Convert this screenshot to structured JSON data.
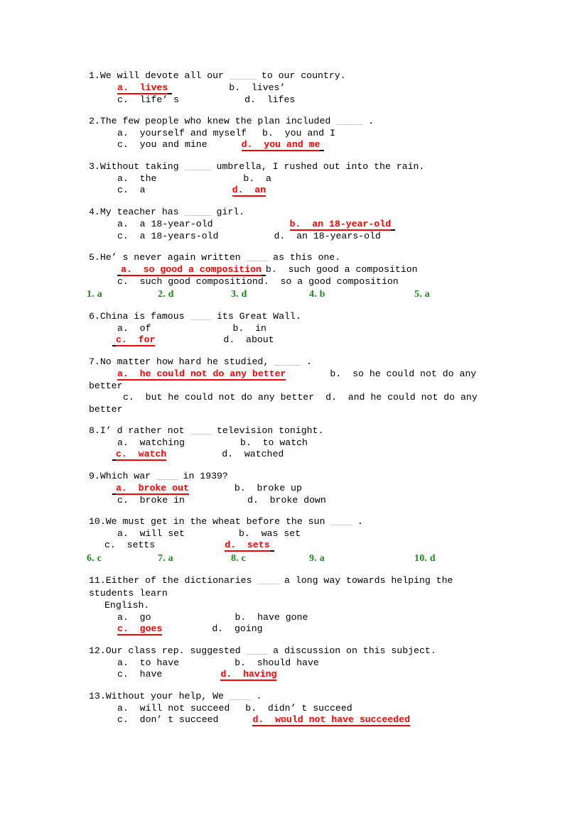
{
  "document": {
    "type": "multiple-choice-grammar-worksheet",
    "colors": {
      "answer_red": "#ff0000",
      "answer_key_green": "#1a8a1a",
      "body_text": "#000000",
      "blank_gray": "#aaaaaa",
      "page_background": "#ffffff"
    }
  },
  "questions": [
    {
      "number": "1.",
      "stem_before": "We will devote all our ",
      "blank": "_____",
      "stem_after": " to our country.",
      "a": "a.  lives",
      "b": "b.  lives’",
      "c": "c.  life’ s",
      "d": "d.  lifes",
      "correct": "a"
    },
    {
      "number": "2.",
      "stem_before": "The few people who knew the plan included ",
      "blank": "_____",
      "stem_after": " .",
      "a": "a.  yourself and myself",
      "b": "b.  you and I",
      "c": "c.  you and mine",
      "d": "d.  you and me",
      "correct": "d"
    },
    {
      "number": "3.",
      "stem_before": "Without taking ",
      "blank": "_____",
      "stem_after": " umbrella, I rushed out into the rain.",
      "a": "a.  the",
      "b": "b.  a",
      "c": "c.  a",
      "d": "d.  an",
      "correct": "d"
    },
    {
      "number": "4.",
      "stem_before": "My teacher has ",
      "blank": "_____",
      "stem_after": " girl.",
      "a": "a.  a 18-year-old",
      "b": "b.  an 18-year-old",
      "c": "c.  a 18-years-old",
      "d": "d.  an 18-years-old",
      "correct": "b"
    },
    {
      "number": "5.",
      "stem_before": "He’ s never again written ",
      "blank": "____",
      "stem_after": " as this one.",
      "a": "a.  so good a composition",
      "b": "b.  such good a composition",
      "c": "c.  such good composition",
      "d": "d.  so a good composition",
      "correct": "a"
    },
    {
      "number": "6.",
      "stem_before": "China is famous ",
      "blank": "____",
      "stem_after": " its Great Wall.",
      "a": "a.  of",
      "b": "b.  in",
      "c": "c.  for",
      "d": "d.  about",
      "correct": "c"
    },
    {
      "number": "7.",
      "stem_before": "No matter how hard he studied, ",
      "blank": "_____",
      "stem_after": " .",
      "a": "a.  he could not do any better",
      "b": "b.  so he could not do any better",
      "c": "c.  but he could not do any better",
      "d": "d.  and he could not do any better",
      "correct": "a"
    },
    {
      "number": "8.",
      "stem_before": "I’ d rather not ",
      "blank": "____",
      "stem_after": " television tonight.",
      "a": "a.  watching",
      "b": "b.  to watch",
      "c": "c.  watch",
      "d": "d.  watched",
      "correct": "c"
    },
    {
      "number": "9.",
      "stem_before": "Which war ",
      "blank": "____",
      "stem_after": " in 1939?",
      "a": "a.  broke out",
      "b": "b.  broke up",
      "c": "c.  broke in",
      "d": "d.  broke down",
      "correct": "a"
    },
    {
      "number": "10.",
      "stem_before": "We must get in the wheat before the sun ",
      "blank": "____",
      "stem_after": " .",
      "a": "a.  will set",
      "b": "b.  was set",
      "c": "c.  setts",
      "d": "d.  sets",
      "correct": "d"
    },
    {
      "number": "11.",
      "stem_before": "Either of the dictionaries ",
      "blank": "____",
      "stem_after": " a long way towards helping the students learn",
      "stem_line3": "English.",
      "a": "a.  go",
      "b": "b.  have gone",
      "c": "c.  goes",
      "d": "d.  going",
      "correct": "c"
    },
    {
      "number": "12.",
      "stem_before": "Our class rep. suggested ",
      "blank": "____",
      "stem_after": " a discussion on this subject.",
      "a": "a.  to have",
      "b": "b.  should have",
      "c": "c.  have",
      "d": "d.  having",
      "correct": "d"
    },
    {
      "number": "13.",
      "stem_before": "Without your help, We ",
      "blank": "____",
      "stem_after": " .",
      "a": "a.  will not succeed",
      "b": "b.  didn’ t succeed",
      "c": "c.  don’ t succeed",
      "d": "d.  would not have succeeded",
      "correct": "d"
    }
  ],
  "answer_keys": [
    {
      "id": "key-1-5",
      "items": [
        {
          "label": "1. a"
        },
        {
          "label": "2. d"
        },
        {
          "label": "3. d"
        },
        {
          "label": "4. b"
        },
        {
          "label": "5. a"
        }
      ]
    },
    {
      "id": "key-6-10",
      "items": [
        {
          "label": "6. c"
        },
        {
          "label": "7. a"
        },
        {
          "label": "8. c"
        },
        {
          "label": "9. a"
        },
        {
          "label": "10. d"
        }
      ]
    }
  ]
}
